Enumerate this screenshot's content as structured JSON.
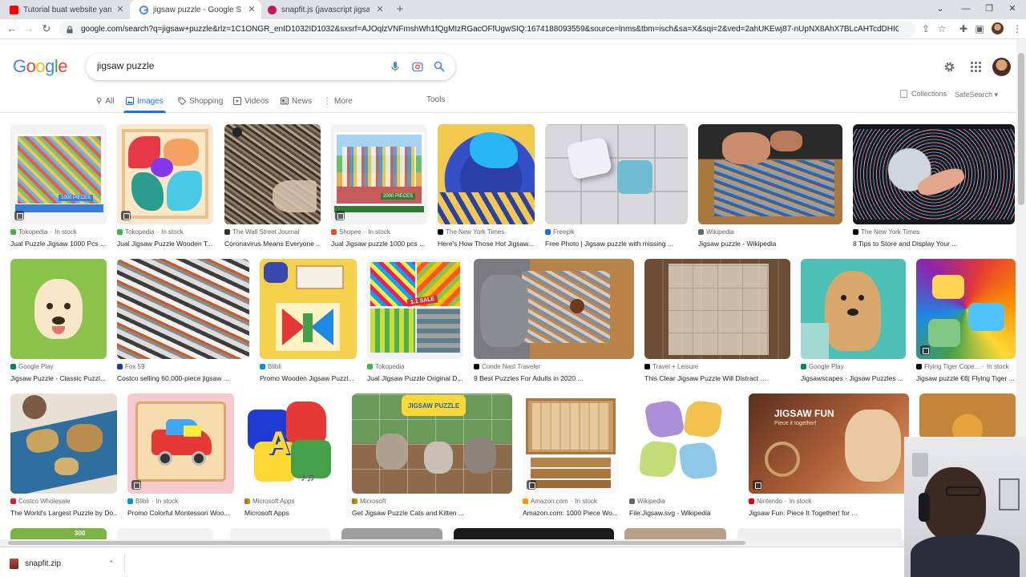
{
  "browser": {
    "tabs": [
      {
        "title": "Tutorial buat website yang terint",
        "favicon_color": "#ff0000",
        "icon": "youtube-icon"
      },
      {
        "title": "jigsaw puzzle - Google Search",
        "favicon_color": "#4285f4",
        "icon": "google-icon"
      },
      {
        "title": "snapfit.js (javascript jigsaw puzzl",
        "favicon_color": "#c2185b",
        "icon": "site-icon"
      }
    ],
    "new_tab": "+",
    "url": "google.com/search?q=jigsaw+puzzle&rlz=1C1ONGR_enID1032ID1032&sxsrf=AJOqlzVNFmshWh1fQgMIzRGacOFfUgwSIQ:1674188093559&source=lnms&tbm=isch&sa=X&sqi=2&ved=2ahUKEwj87-nUpNX8AhX7BLcAHTcdDHIQ_AUoAXoECAEQAw&bi..."
  },
  "search": {
    "logo": [
      "G",
      "o",
      "o",
      "g",
      "l",
      "e"
    ],
    "logo_colors": [
      "#4285f4",
      "#ea4335",
      "#fbbc05",
      "#4285f4",
      "#34a853",
      "#ea4335"
    ],
    "query": "jigsaw puzzle"
  },
  "nav": {
    "all": "All",
    "images": "Images",
    "shopping": "Shopping",
    "videos": "Videos",
    "news": "News",
    "more": "More",
    "tools": "Tools",
    "collections": "Collections",
    "safesearch": "SafeSearch ▾"
  },
  "results": [
    {
      "source": "Tokopedia",
      "stock": "In stock",
      "caption": "Jual Puzzle Jigsaw 1000 Pcs ...",
      "icon_color": "#42b549"
    },
    {
      "source": "Tokopedia",
      "stock": "In stock",
      "caption": "Jual Jigsaw Puzzle Wooden T...",
      "icon_color": "#42b549"
    },
    {
      "source": "The Wall Street Journal",
      "stock": "",
      "caption": "Coronavirus Means Everyone ...",
      "icon_color": "#333333"
    },
    {
      "source": "Shopee",
      "stock": "In stock",
      "caption": "Jual Jigsaw puzzle 1000 pcs ...",
      "icon_color": "#ee4d2d"
    },
    {
      "source": "The New York Times",
      "stock": "",
      "caption": "Here's How Those Hot Jigsaw...",
      "icon_color": "#000000"
    },
    {
      "source": "Freepik",
      "stock": "",
      "caption": "Free Photo | Jigsaw puzzle with missing ...",
      "icon_color": "#1273eb"
    },
    {
      "source": "Wikipedia",
      "stock": "",
      "caption": "Jigsaw puzzle - Wikipedia",
      "icon_color": "#666666"
    },
    {
      "source": "The New York Times",
      "stock": "",
      "caption": "8 Tips to Store and Display Your ...",
      "icon_color": "#000000"
    },
    {
      "source": "Google Play",
      "stock": "",
      "caption": "Jigsaw Puzzle - Classic Puzzl...",
      "icon_color": "#01875f"
    },
    {
      "source": "Fox 59",
      "stock": "",
      "caption": "Costco selling 60,000-piece jigsaw ...",
      "icon_color": "#1f3f8a"
    },
    {
      "source": "Blibli",
      "stock": "",
      "caption": "Promo Wooden Jigsaw Puzzl...",
      "icon_color": "#0095da"
    },
    {
      "source": "Tokopedia",
      "stock": "",
      "caption": "Jual JIgsaw Puzzle Original D...",
      "icon_color": "#42b549"
    },
    {
      "source": "Conde Nast Traveler",
      "stock": "",
      "caption": "9 Best Puzzles For Adults in 2020 ...",
      "icon_color": "#000000"
    },
    {
      "source": "Travel + Leisure",
      "stock": "",
      "caption": "This Clear Jigsaw Puzzle Will Distract ...",
      "icon_color": "#000000"
    },
    {
      "source": "Google Play",
      "stock": "",
      "caption": "Jigsawscapes - Jigsaw Puzzles ...",
      "icon_color": "#01875f"
    },
    {
      "source": "Flying Tiger Cope...",
      "stock": "In stock",
      "caption": "Jigsaw puzzle €6| Flying Tiger ...",
      "icon_color": "#000000"
    },
    {
      "source": "Costco Wholesale",
      "stock": "",
      "caption": "The World's Largest Puzzle by Do...",
      "icon_color": "#e31837"
    },
    {
      "source": "Blibli",
      "stock": "In stock",
      "caption": "Promo Colorful Montessori Woo...",
      "icon_color": "#0095da"
    },
    {
      "source": "Microsoft Apps",
      "stock": "",
      "caption": "Microsoft Apps",
      "icon_color": "#f25022"
    },
    {
      "source": "Microsoft",
      "stock": "",
      "caption": "Get Jigsaw Puzzle Cats and Kitten ...",
      "icon_color": "#f25022"
    },
    {
      "source": "Amazon.com",
      "stock": "In stock",
      "caption": "Amazon.com: 1000 Piece Wo...",
      "icon_color": "#ff9900"
    },
    {
      "source": "Wikipedia",
      "stock": "",
      "caption": "File:Jigsaw.svg - Wikipedia",
      "icon_color": "#666666"
    },
    {
      "source": "Nintendo",
      "stock": "In stock",
      "caption": "Jigsaw Fun: Piece It Together! for ...",
      "icon_color": "#e60012"
    }
  ],
  "thumb_texts": {
    "pieces_1000": "1000 PIECES",
    "pieces_2000": "2000 PIECES",
    "sale": "1.1 SALE",
    "jigsaw_puzzle": "JIGSAW PUZZLE",
    "jigsaw_fun": "JIGSAW FUN",
    "jigsaw_fun_sub": "Piece it together!",
    "pieces_300": "300"
  },
  "download": {
    "filename": "snapfit.zip",
    "chevron": "⌃"
  },
  "colors": {
    "accent": "#1a73e8",
    "tabstrip": "#dee1e6"
  }
}
